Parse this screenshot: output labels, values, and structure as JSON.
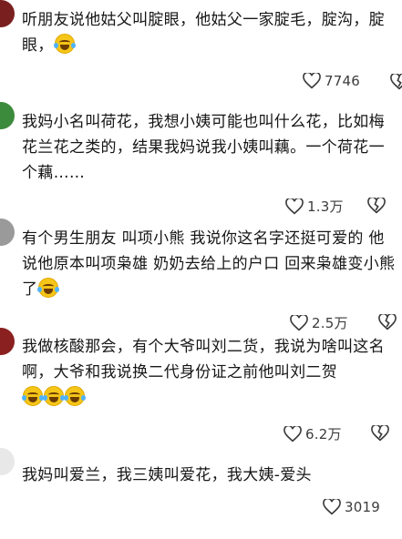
{
  "comments": [
    {
      "text": "听朋友说他姑父叫腚眼，他姑父一家腚毛，腚沟，腚眼，",
      "emoji_count": 1,
      "likes": "7746",
      "avatar_color": "#7a1f1f"
    },
    {
      "text": "我妈小名叫荷花，我想小姨可能也叫什么花，比如梅花兰花之类的，结果我妈说我小姨叫藕。一个荷花一个藕……",
      "emoji_count": 0,
      "likes": "1.3万",
      "avatar_color": "#3c8a3c"
    },
    {
      "text": "有个男生朋友 叫项小熊 我说你这名字还挺可爱的 他说他原本叫项枭雄 奶奶去给上的户口 回来枭雄变小熊了",
      "emoji_count": 1,
      "likes": "2.5万",
      "avatar_color": "#9a9a9a"
    },
    {
      "text": "我做核酸那会，有个大爷叫刘二货，我说为啥叫这名啊，大爷和我说换二代身份证之前他叫刘二贺",
      "emoji_count": 3,
      "likes": "6.2万",
      "avatar_color": "#8a2020"
    },
    {
      "text": "我妈叫爱兰，我三姨叫爱花，我大姨-爱头",
      "emoji_count": 0,
      "likes": "3019",
      "avatar_color": "#e8e8e8"
    }
  ]
}
